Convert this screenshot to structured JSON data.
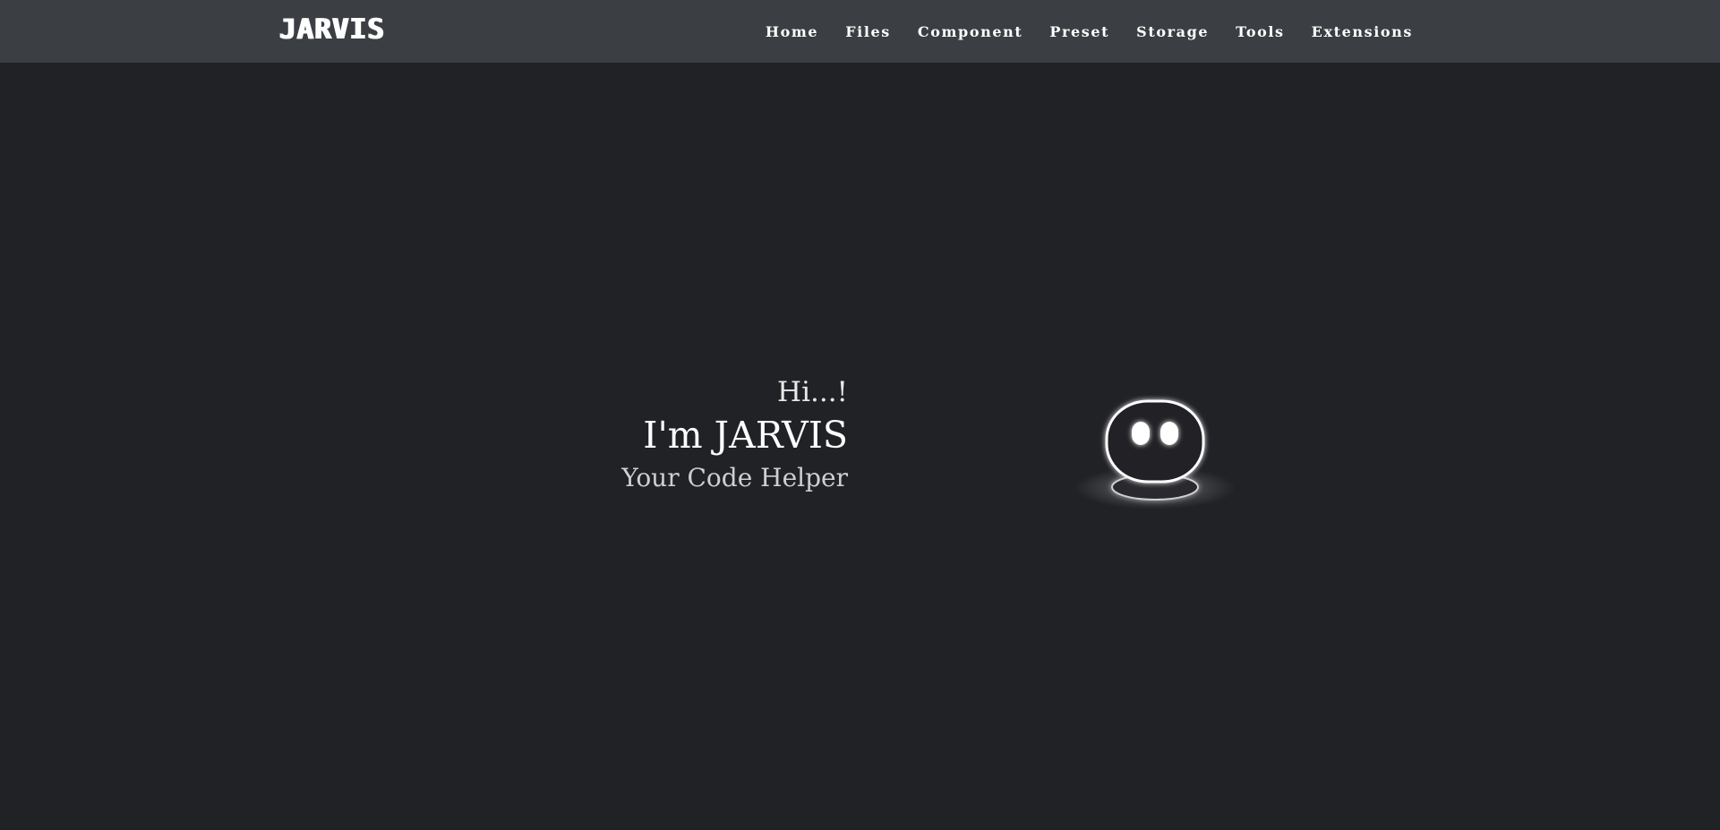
{
  "header": {
    "brand": "JARVIS",
    "nav": [
      "Home",
      "Files",
      "Component",
      "Preset",
      "Storage",
      "Tools",
      "Extensions"
    ]
  },
  "hero": {
    "greeting": "Hi...!",
    "title": "I'm JARVIS",
    "subtitle": "Your Code Helper"
  },
  "mascot": {
    "icon": "robot-ghost-icon"
  },
  "colors": {
    "background": "#212226",
    "navbar": "#3b3f43",
    "text": "#ffffff"
  }
}
